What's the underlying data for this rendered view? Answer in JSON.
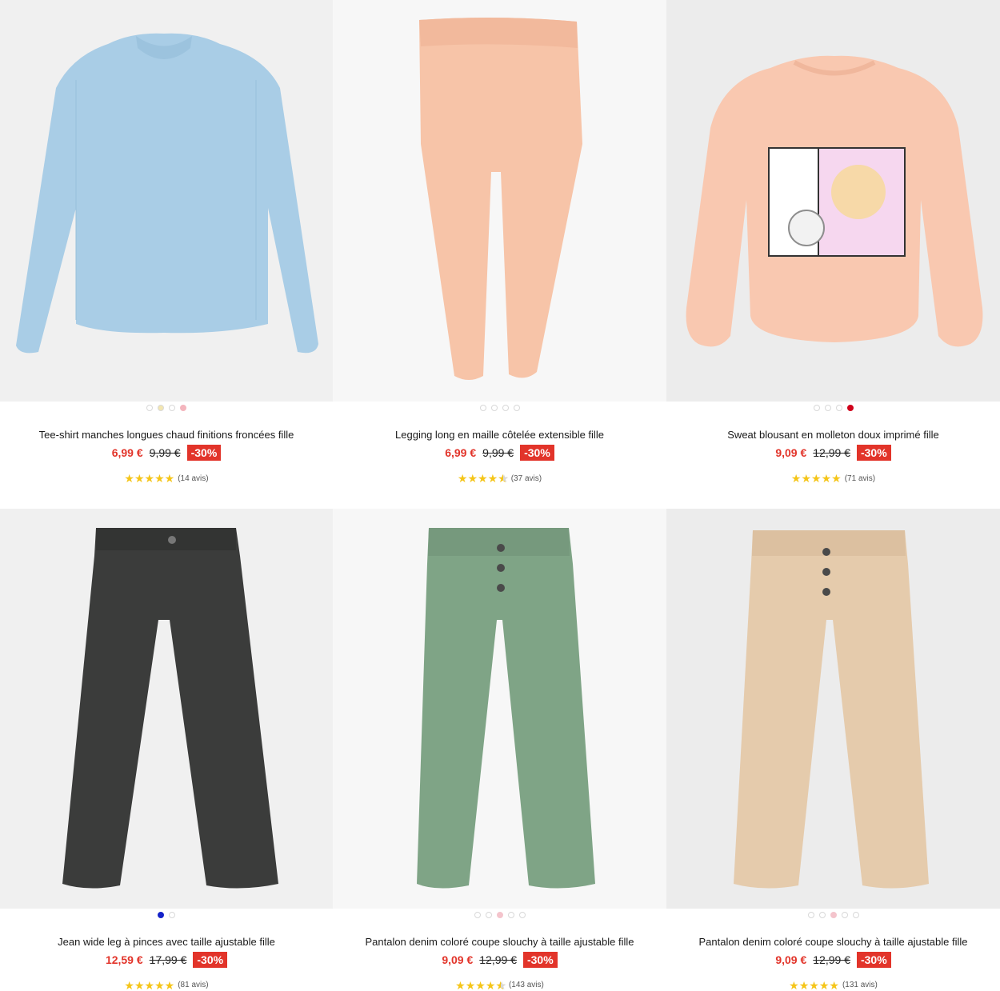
{
  "products": [
    {
      "title": "Tee-shirt manches longues chaud finitions froncées fille",
      "price": "6,99 €",
      "old_price": "9,99 €",
      "discount": "-30%",
      "reviews": "(14 avis)",
      "rating": 5,
      "swatches": [
        "#ffffff",
        "#f3e6b0",
        "#ffffff",
        "#f4b5bd"
      ],
      "selected_swatch": 3,
      "garment_color": "#a9cde6"
    },
    {
      "title": "Legging long en maille côtelée extensible fille",
      "price": "6,99 €",
      "old_price": "9,99 €",
      "discount": "-30%",
      "reviews": "(37 avis)",
      "rating": 4.5,
      "swatches": [
        "#ffffff",
        "#ffffff",
        "#ffffff",
        "#ffffff"
      ],
      "selected_swatch": 0,
      "garment_color": "#f7c4a8"
    },
    {
      "title": "Sweat blousant en molleton doux imprimé fille",
      "price": "9,09 €",
      "old_price": "12,99 €",
      "discount": "-30%",
      "reviews": "(71 avis)",
      "rating": 5,
      "swatches": [
        "#ffffff",
        "#ffffff",
        "#ffffff",
        "#d0021b"
      ],
      "selected_swatch": 3,
      "garment_color": "#f9c8b0"
    },
    {
      "title": "Jean wide leg à pinces avec taille ajustable fille",
      "price": "12,59 €",
      "old_price": "17,99 €",
      "discount": "-30%",
      "reviews": "(81 avis)",
      "rating": 5,
      "swatches": [
        "#1523c9",
        "#ffffff"
      ],
      "selected_swatch": 0,
      "garment_color": "#3b3c3b"
    },
    {
      "title": "Pantalon denim coloré coupe slouchy à taille ajustable fille",
      "price": "9,09 €",
      "old_price": "12,99 €",
      "discount": "-30%",
      "reviews": "(143 avis)",
      "rating": 4.5,
      "swatches": [
        "#ffffff",
        "#ffffff",
        "#f4c4cc",
        "#ffffff",
        "#ffffff"
      ],
      "selected_swatch": 2,
      "garment_color": "#7fa486"
    },
    {
      "title": "Pantalon denim coloré coupe slouchy à taille ajustable fille",
      "price": "9,09 €",
      "old_price": "12,99 €",
      "discount": "-30%",
      "reviews": "(131 avis)",
      "rating": 5,
      "swatches": [
        "#ffffff",
        "#ffffff",
        "#f4c4cc",
        "#ffffff",
        "#ffffff"
      ],
      "selected_swatch": 2,
      "garment_color": "#e5cbac"
    }
  ],
  "colors": {
    "accent_red": "#e2342a",
    "star_yellow": "#f5c518"
  }
}
